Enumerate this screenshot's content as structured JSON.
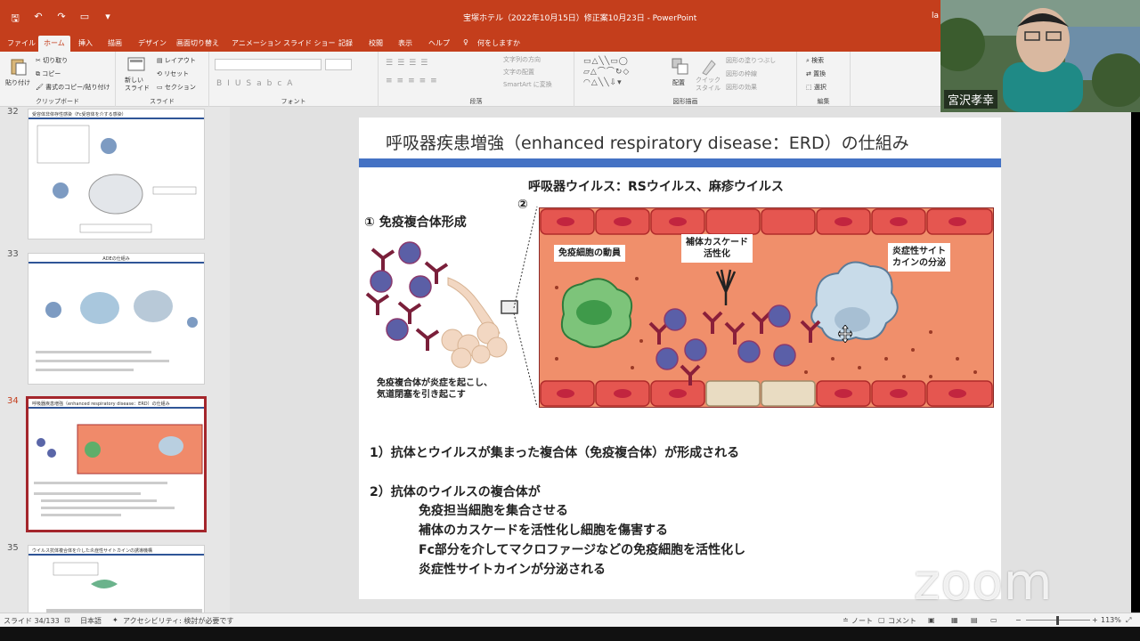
{
  "window": {
    "title": "宝塚ホテル（2022年10月15日）修正案10月23日 - PowerPoint",
    "user_fragment": "la"
  },
  "tabs": [
    "ファイル",
    "ホーム",
    "挿入",
    "描画",
    "デザイン",
    "画面切り替え",
    "アニメーション",
    "スライド ショー",
    "記録",
    "校閲",
    "表示",
    "ヘルプ",
    "何をしますか"
  ],
  "ribbon": {
    "paste": "貼り付け",
    "cut": "切り取り",
    "copy": "コピー",
    "format_painter": "書式のコピー/貼り付け",
    "clipboard": "クリップボード",
    "new_slide": "新しい\nスライド",
    "layout": "レイアウト",
    "reset": "リセット",
    "section": "セクション",
    "slides": "スライド",
    "font": "フォント",
    "text_direction": "文字列の方向",
    "align_text": "文字の配置",
    "smartart": "SmartArt に変換",
    "paragraph": "段落",
    "arrange": "配置",
    "quick_styles": "クイック\nスタイル",
    "shape_fill": "図形の塗りつぶし",
    "shape_outline": "図形の枠線",
    "shape_effects": "図形の効果",
    "drawing": "図形描画",
    "find": "検索",
    "replace": "置換",
    "select": "選択",
    "editing": "編集"
  },
  "thumbnails": [
    {
      "num": "32",
      "title": "受容体非依存性感染（Fc受容体を介する感染）"
    },
    {
      "num": "33",
      "title": "ADEの仕組み"
    },
    {
      "num": "34",
      "title": "呼吸器疾患増強（enhanced respiratory disease：ERD）の仕組み"
    },
    {
      "num": "35",
      "title": "ウイルス抗体複合体を介した炎症性サイトカインの誘導機構"
    }
  ],
  "slide": {
    "title": "呼吸器疾患増強（enhanced respiratory disease：ERD）の仕組み",
    "virus_heading": "呼吸器ウイルス：RSウイルス、麻疹ウイルス",
    "section1": "① 免疫複合体形成",
    "section2": "②",
    "caption_left": "免疫複合体が炎症を起こし、\n気道閉塞を引き起こす",
    "label_immune_cells": "免疫細胞の動員",
    "label_complement": "補体カスケード\n活性化",
    "label_cytokine": "炎症性サイト\nカインの分泌",
    "point1": "1）抗体とウイルスが集まった複合体（免疫複合体）が形成される",
    "point2": "2）抗体のウイルスの複合体が",
    "point2_lines": [
      "免疫担当細胞を集合させる",
      "補体のカスケードを活性化し細胞を傷害する",
      "Fc部分を介してマクロファージなどの免疫細胞を活性化し",
      "炎症性サイトカインが分泌される"
    ]
  },
  "video": {
    "name": "宮沢孝幸"
  },
  "watermark": "zoom",
  "status": {
    "slide": "スライド 34/133",
    "language": "日本語",
    "accessibility": "アクセシビリティ: 検討が必要です",
    "notes": "ノート",
    "comments": "コメント",
    "zoom": "113%"
  }
}
